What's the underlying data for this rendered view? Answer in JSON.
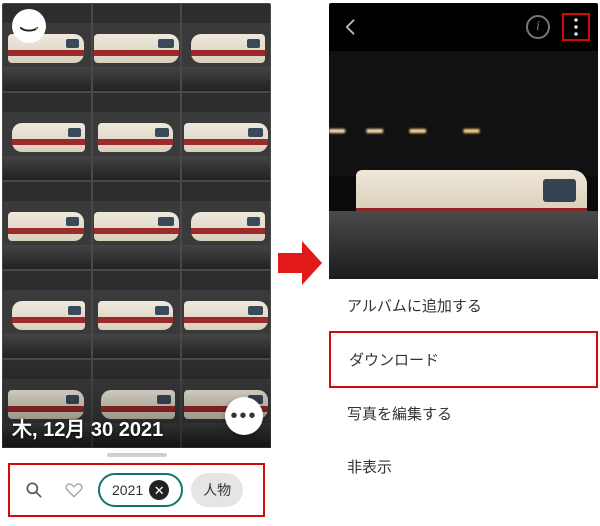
{
  "left": {
    "date_label": "木, 12月 30 2021",
    "filter": {
      "year_chip": "2021",
      "people_chip": "人物"
    }
  },
  "right": {
    "menu": {
      "add_to_album": "アルバムに追加する",
      "download": "ダウンロード",
      "edit_photo": "写真を編集する",
      "hide": "非表示"
    }
  }
}
